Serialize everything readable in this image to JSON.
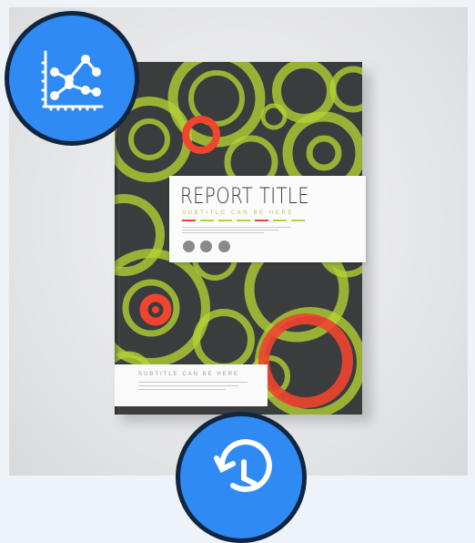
{
  "cover": {
    "title": "REPORT TITLE",
    "subtitle": "SUBTITLE CAN BE HERE",
    "bottom_subtitle": "SUBTITLE CAN BE HERE"
  },
  "colors": {
    "cover_background": "#3b3c3e",
    "ring_green": "#b3d335",
    "ring_red": "#f0442e",
    "badge_blue": "#2f8bf3",
    "badge_border": "#10253f"
  },
  "badges": {
    "top_left_icon": "line-chart-icon",
    "bottom_icon": "history-icon"
  }
}
